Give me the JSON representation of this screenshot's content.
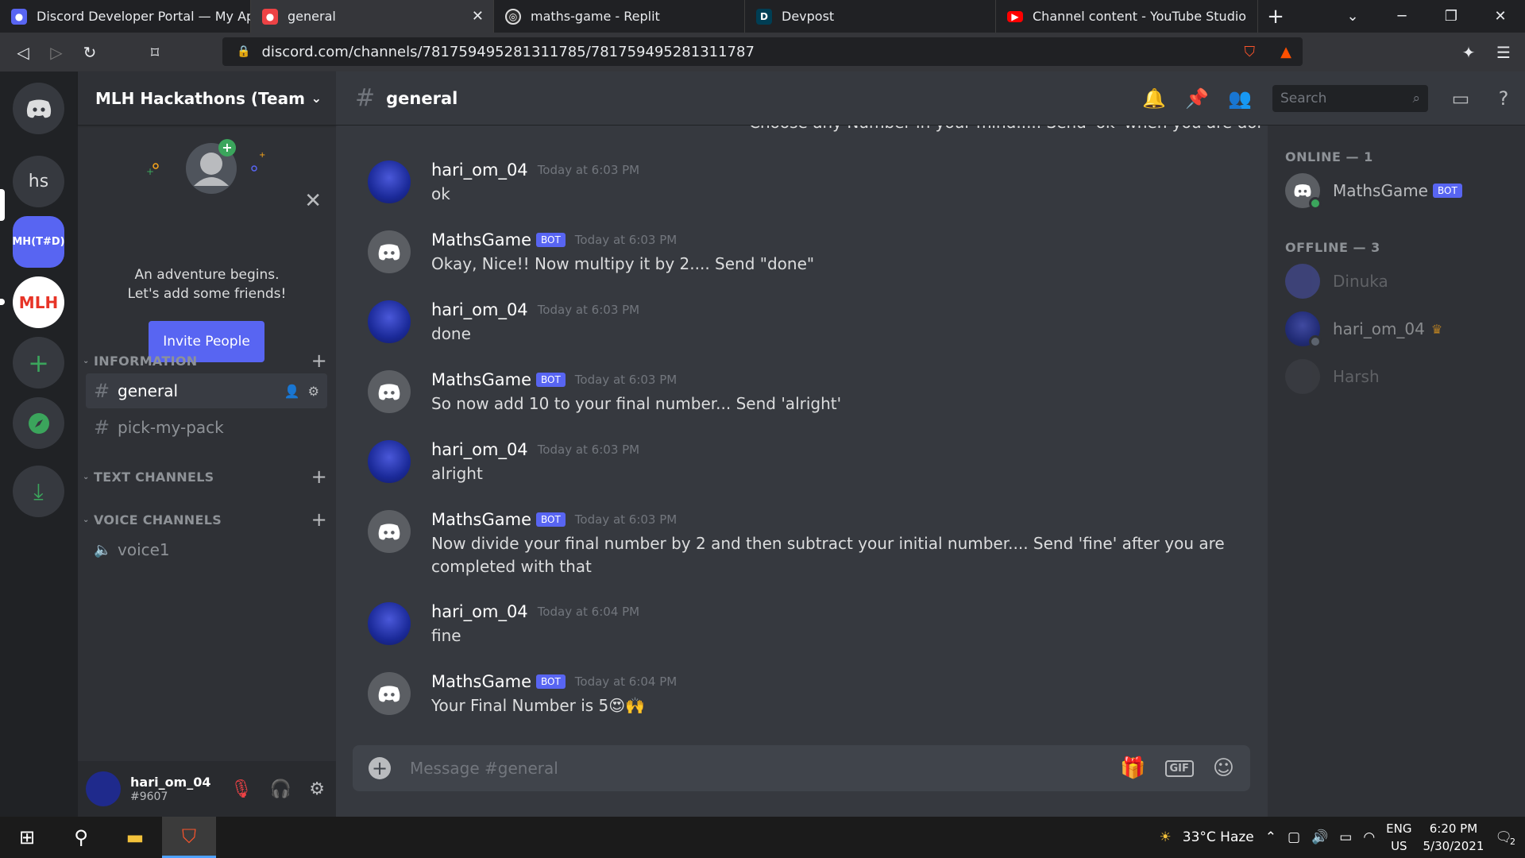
{
  "browser": {
    "tabs": [
      {
        "title": "Discord Developer Portal — My Appl",
        "icon": "discord-icon",
        "color": "#5865f2"
      },
      {
        "title": "general",
        "icon": "discord-icon",
        "color": "#ed4245",
        "active": true
      },
      {
        "title": "maths-game - Replit",
        "icon": "replit-icon",
        "color": "#2d2d2d"
      },
      {
        "title": "Devpost",
        "icon": "devpost-icon",
        "color": "#003e54"
      },
      {
        "title": "Channel content - YouTube Studio",
        "icon": "youtube-icon",
        "color": "#ff0000"
      }
    ],
    "url": "discord.com/channels/781759495281311785/781759495281311787"
  },
  "guilds": [
    {
      "label": "hs"
    },
    {
      "label": "MH(T#D)",
      "color": "#5865f2"
    },
    {
      "label": "MLH"
    }
  ],
  "server": {
    "name": "MLH Hackathons (Team ...",
    "invite_text_line1": "An adventure begins.",
    "invite_text_line2": "Let's add some friends!",
    "invite_button": "Invite People",
    "categories": [
      {
        "name": "INFORMATION",
        "channels": [
          "general",
          "pick-my-pack"
        ]
      },
      {
        "name": "TEXT CHANNELS",
        "channels": []
      },
      {
        "name": "VOICE CHANNELS",
        "channels": [
          "voice1"
        ]
      }
    ]
  },
  "user": {
    "name": "hari_om_04",
    "tag": "#9607"
  },
  "channel": {
    "name": "general",
    "search_placeholder": "Search"
  },
  "chat": {
    "clipped_top": "Choose any Number in your mind..... Send 'ok' when you are done",
    "messages": [
      {
        "author": "hari_om_04",
        "bot": false,
        "time": "Today at 6:03 PM",
        "text": "ok"
      },
      {
        "author": "MathsGame",
        "bot": true,
        "time": "Today at 6:03 PM",
        "text": "Okay, Nice!! Now multipy it by 2....  Send \"done\""
      },
      {
        "author": "hari_om_04",
        "bot": false,
        "time": "Today at 6:03 PM",
        "text": "done"
      },
      {
        "author": "MathsGame",
        "bot": true,
        "time": "Today at 6:03 PM",
        "text": "So now add 10 to your final number... Send 'alright'"
      },
      {
        "author": "hari_om_04",
        "bot": false,
        "time": "Today at 6:03 PM",
        "text": "alright"
      },
      {
        "author": "MathsGame",
        "bot": true,
        "time": "Today at 6:03 PM",
        "text": "Now divide your final number by 2 and then subtract your initial number.... Send 'fine' after you are completed with that"
      },
      {
        "author": "hari_om_04",
        "bot": false,
        "time": "Today at 6:04 PM",
        "text": "fine"
      },
      {
        "author": "MathsGame",
        "bot": true,
        "time": "Today at 6:04 PM",
        "text": "Your Final Number is 5😍🙌"
      }
    ],
    "bot_badge": "BOT",
    "composer_placeholder": "Message #general",
    "gif_label": "GIF"
  },
  "members": {
    "online_header": "ONLINE — 1",
    "offline_header": "OFFLINE — 3",
    "online": [
      {
        "name": "MathsGame",
        "bot": true
      }
    ],
    "offline": [
      {
        "name": "Dinuka"
      },
      {
        "name": "hari_om_04",
        "crown": true
      },
      {
        "name": "Harsh"
      }
    ]
  },
  "taskbar": {
    "weather": "33°C  Haze",
    "lang1": "ENG",
    "lang2": "US",
    "time": "6:20 PM",
    "date": "5/30/2021",
    "notif_count": "2"
  }
}
